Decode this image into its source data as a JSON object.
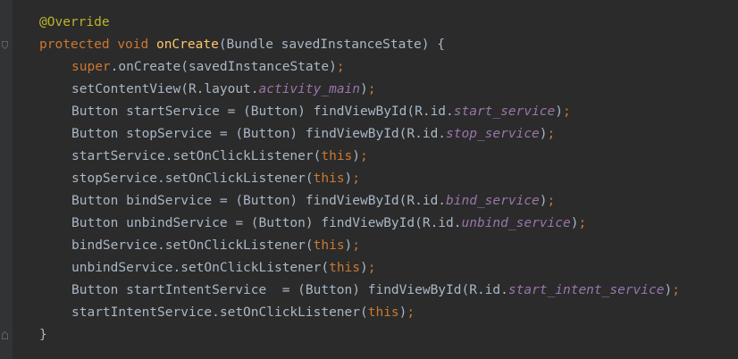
{
  "editor": {
    "lines": [
      {
        "indent": false,
        "tokens": [
          {
            "t": "@Override",
            "c": "ann"
          }
        ]
      },
      {
        "indent": false,
        "tokens": [
          {
            "t": "protected",
            "c": "kw"
          },
          {
            "t": " ",
            "c": "txt"
          },
          {
            "t": "void",
            "c": "kw"
          },
          {
            "t": " ",
            "c": "txt"
          },
          {
            "t": "onCreate",
            "c": "fn"
          },
          {
            "t": "(Bundle savedInstanceState) {",
            "c": "txt"
          }
        ]
      },
      {
        "indent": true,
        "tokens": [
          {
            "t": "super",
            "c": "kw"
          },
          {
            "t": ".onCreate(savedInstanceState)",
            "c": "txt"
          },
          {
            "t": ";",
            "c": "kw"
          }
        ]
      },
      {
        "indent": true,
        "tokens": [
          {
            "t": "setContentView(R.layout.",
            "c": "txt"
          },
          {
            "t": "activity_main",
            "c": "fld"
          },
          {
            "t": ")",
            "c": "txt"
          },
          {
            "t": ";",
            "c": "kw"
          }
        ]
      },
      {
        "indent": true,
        "tokens": [
          {
            "t": "Button startService = (Button) findViewById(R.id.",
            "c": "txt"
          },
          {
            "t": "start_service",
            "c": "fld"
          },
          {
            "t": ")",
            "c": "txt"
          },
          {
            "t": ";",
            "c": "kw"
          }
        ]
      },
      {
        "indent": true,
        "tokens": [
          {
            "t": "Button stopService = (Button) findViewById(R.id.",
            "c": "txt"
          },
          {
            "t": "stop_service",
            "c": "fld"
          },
          {
            "t": ")",
            "c": "txt"
          },
          {
            "t": ";",
            "c": "kw"
          }
        ]
      },
      {
        "indent": true,
        "tokens": [
          {
            "t": "startService.setOnClickListener(",
            "c": "txt"
          },
          {
            "t": "this",
            "c": "kw"
          },
          {
            "t": ")",
            "c": "txt"
          },
          {
            "t": ";",
            "c": "kw"
          }
        ]
      },
      {
        "indent": true,
        "tokens": [
          {
            "t": "stopService.setOnClickListener(",
            "c": "txt"
          },
          {
            "t": "this",
            "c": "kw"
          },
          {
            "t": ")",
            "c": "txt"
          },
          {
            "t": ";",
            "c": "kw"
          }
        ]
      },
      {
        "indent": true,
        "tokens": [
          {
            "t": "Button bindService = (Button) findViewById(R.id.",
            "c": "txt"
          },
          {
            "t": "bind_service",
            "c": "fld"
          },
          {
            "t": ")",
            "c": "txt"
          },
          {
            "t": ";",
            "c": "kw"
          }
        ]
      },
      {
        "indent": true,
        "tokens": [
          {
            "t": "Button unbindService = (Button) findViewById(R.id.",
            "c": "txt"
          },
          {
            "t": "unbind_service",
            "c": "fld"
          },
          {
            "t": ")",
            "c": "txt"
          },
          {
            "t": ";",
            "c": "kw"
          }
        ]
      },
      {
        "indent": true,
        "tokens": [
          {
            "t": "bindService.setOnClickListener(",
            "c": "txt"
          },
          {
            "t": "this",
            "c": "kw"
          },
          {
            "t": ")",
            "c": "txt"
          },
          {
            "t": ";",
            "c": "kw"
          }
        ]
      },
      {
        "indent": true,
        "tokens": [
          {
            "t": "unbindService.setOnClickListener(",
            "c": "txt"
          },
          {
            "t": "this",
            "c": "kw"
          },
          {
            "t": ")",
            "c": "txt"
          },
          {
            "t": ";",
            "c": "kw"
          }
        ]
      },
      {
        "indent": true,
        "tokens": [
          {
            "t": "Button startIntentService  = (Button) findViewById(R.id.",
            "c": "txt"
          },
          {
            "t": "start_intent_service",
            "c": "fld"
          },
          {
            "t": ")",
            "c": "txt"
          },
          {
            "t": ";",
            "c": "kw"
          }
        ]
      },
      {
        "indent": true,
        "tokens": [
          {
            "t": "startIntentService.setOnClickListener(",
            "c": "txt"
          },
          {
            "t": "this",
            "c": "kw"
          },
          {
            "t": ")",
            "c": "txt"
          },
          {
            "t": ";",
            "c": "kw"
          }
        ]
      },
      {
        "indent": false,
        "tokens": [
          {
            "t": "}",
            "c": "txt"
          }
        ]
      }
    ],
    "colors": {
      "background": "#2b2b2b",
      "gutter": "#313335",
      "annotation": "#bbb529",
      "keyword": "#cc7832",
      "method_declaration": "#ffc66d",
      "field": "#9876aa",
      "text": "#a9b7c6"
    },
    "icons": [
      "fold-open-icon",
      "fold-close-icon"
    ]
  }
}
